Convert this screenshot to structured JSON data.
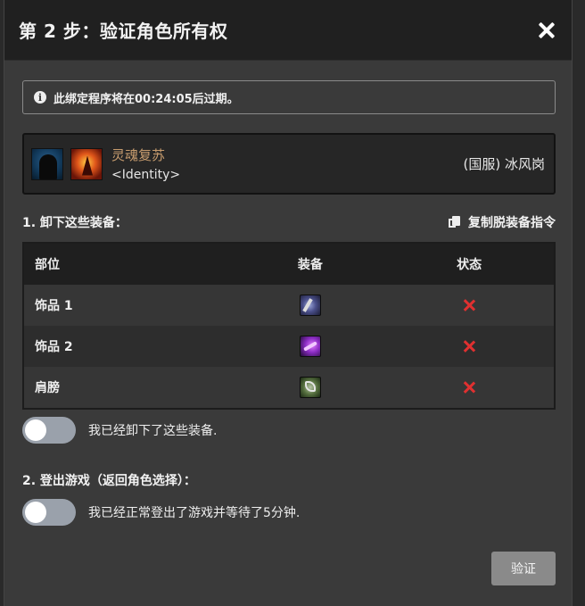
{
  "dialog": {
    "title": "第 2 步：验证角色所有权"
  },
  "notice": {
    "text": "此绑定程序将在00:24:05后过期。"
  },
  "character": {
    "name": "灵魂复苏",
    "guild": "<Identity>",
    "realm": "(国服) 冰风岗",
    "name_color": "#c79c6e"
  },
  "step1": {
    "heading": "1. 卸下这些装备：",
    "copy_label": "复制脱装备指令",
    "table": {
      "headers": [
        "部位",
        "装备",
        "状态"
      ],
      "rows": [
        {
          "slot": "饰品 1",
          "icon": "trinket-dagger-icon",
          "status_icon": "x-icon"
        },
        {
          "slot": "饰品 2",
          "icon": "trinket-purple-icon",
          "status_icon": "x-icon"
        },
        {
          "slot": "肩膀",
          "icon": "shoulder-armor-icon",
          "status_icon": "x-icon"
        }
      ]
    },
    "toggle_label": "我已经卸下了这些装备.",
    "toggle_on": false
  },
  "step2": {
    "heading": "2. 登出游戏（返回角色选择）：",
    "toggle_label": "我已经正常登出了游戏并等待了5分钟.",
    "toggle_on": false
  },
  "actions": {
    "verify_label": "验证"
  },
  "colors": {
    "error_x": "#e03030",
    "toggle_off": "#9aa1ab",
    "button_disabled": "#8a8a8a"
  }
}
